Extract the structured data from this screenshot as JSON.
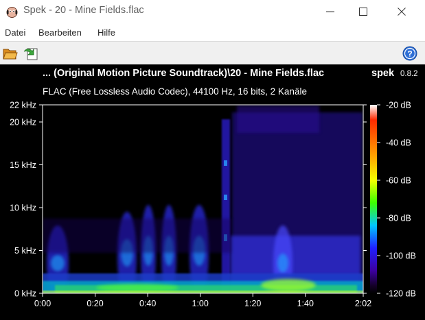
{
  "window": {
    "title": "Spek - 20 - Mine Fields.flac",
    "minimize_icon": "minimize-icon",
    "maximize_icon": "maximize-icon",
    "close_icon": "close-icon"
  },
  "menu": {
    "items": [
      "Datei",
      "Bearbeiten",
      "Hilfe"
    ]
  },
  "toolbar": {
    "open_icon": "folder-open-icon",
    "save_icon": "save-export-icon",
    "help_icon": "help-icon"
  },
  "spectrogram": {
    "file_title": "... (Original Motion Picture Soundtrack)\\20 - Mine Fields.flac",
    "brand": "spek",
    "version": "0.8.2",
    "file_info": "FLAC (Free Lossless Audio Codec), 44100 Hz, 16 bits, 2 Kanäle",
    "freq_ticks": [
      "22 kHz",
      "20 kHz",
      "15 kHz",
      "10 kHz",
      "5 kHz",
      "0 kHz"
    ],
    "freq_values": [
      22,
      20,
      15,
      10,
      5,
      0
    ],
    "freq_max": 22,
    "time_ticks": [
      "0:00",
      "0:20",
      "0:40",
      "1:00",
      "1:20",
      "1:40",
      "2:02"
    ],
    "time_values": [
      0,
      20,
      40,
      60,
      80,
      100,
      122
    ],
    "time_max": 122,
    "db_ticks": [
      "-20 dB",
      "-40 dB",
      "-60 dB",
      "-80 dB",
      "-100 dB",
      "-120 dB"
    ],
    "db_values": [
      -20,
      -40,
      -60,
      -80,
      -100,
      -120
    ],
    "db_range": [
      -120,
      -20
    ],
    "palette": [
      "#ffffff",
      "#ff2a00",
      "#ffa800",
      "#f4ff00",
      "#3cff00",
      "#00c8ff",
      "#2020ff",
      "#3c00a0",
      "#140028",
      "#000000"
    ]
  }
}
